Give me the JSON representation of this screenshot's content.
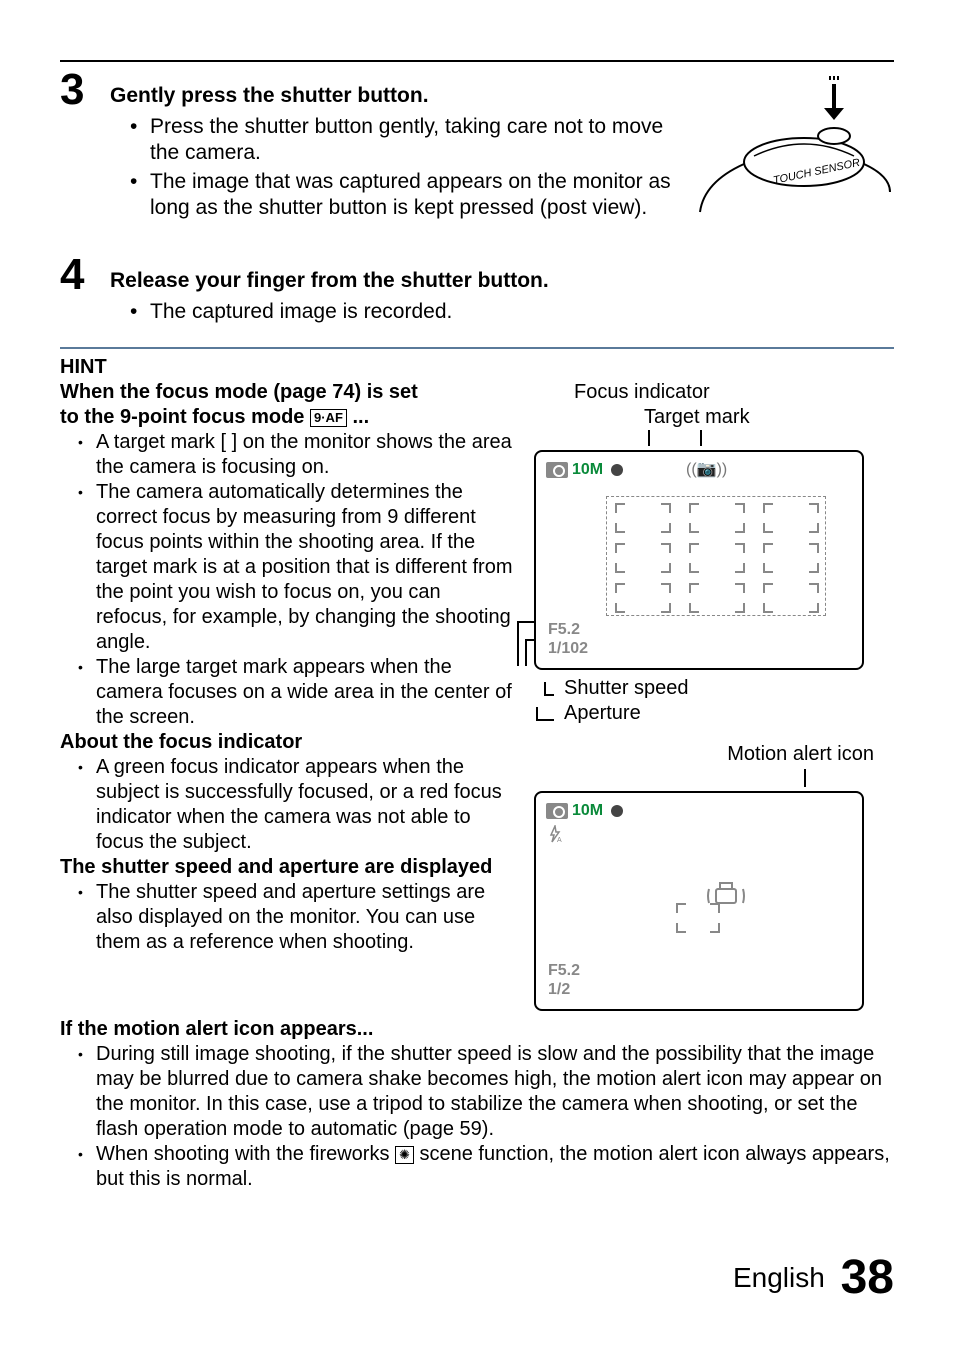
{
  "steps": {
    "s3": {
      "num": "3",
      "title": "Gently press the shutter button.",
      "b1": "Press the shutter button gently, taking care not to move the camera.",
      "b2": "The image that was captured appears on the monitor as long as the shutter button is kept pressed (post view)."
    },
    "s4": {
      "num": "4",
      "title": "Release your finger from the shutter button.",
      "b1": "The captured image is recorded."
    }
  },
  "illus": {
    "touch_sensor": "TOUCH SENSOR"
  },
  "hint": {
    "header": "HINT",
    "h1a": "When the focus mode (page 74) is set",
    "h1b": "to the 9-point focus mode ",
    "h1c": "...",
    "mode_icon": "9·AF",
    "b1": "A target mark [ ] on the monitor shows the area the camera is focusing on.",
    "b2": "The camera automatically determines the correct focus by measuring from 9 different focus points within the shooting area. If the target mark is at a position that is different from the point you wish to focus on, you can refocus, for example, by changing the shooting angle.",
    "b3": "The large target mark appears when the camera focuses on a wide area in the center of the screen.",
    "h2": "About the focus indicator",
    "b4": "A green focus indicator appears when the subject is successfully focused, or a red focus indicator when the camera was not able to focus the subject.",
    "h3": "The shutter speed and aperture are displayed",
    "b5": "The shutter speed and aperture settings are also displayed on the monitor. You can use them as a reference when shooting.",
    "h4": "If the motion alert icon appears...",
    "b6": "During still image shooting, if the shutter speed is slow and the possibility that the image may be blurred due to camera shake becomes high, the motion alert icon may appear on the monitor. In this case, use a tripod to stabilize the camera when shooting, or set the flash operation mode to automatic (page 59).",
    "b7a": "When shooting with the fireworks ",
    "b7b": " scene function, the motion alert icon always appears, but this is normal."
  },
  "monitor1": {
    "focus_indicator": "Focus indicator",
    "target_mark": "Target mark",
    "ten_m": "10M",
    "aperture": "F5.2",
    "shutter": "1/102",
    "lbl_shutter": "Shutter speed",
    "lbl_aperture": "Aperture"
  },
  "monitor2": {
    "motion_label": "Motion alert icon",
    "ten_m": "10M",
    "aperture": "F5.2",
    "shutter": "1/2"
  },
  "footer": {
    "lang": "English",
    "page": "38"
  }
}
